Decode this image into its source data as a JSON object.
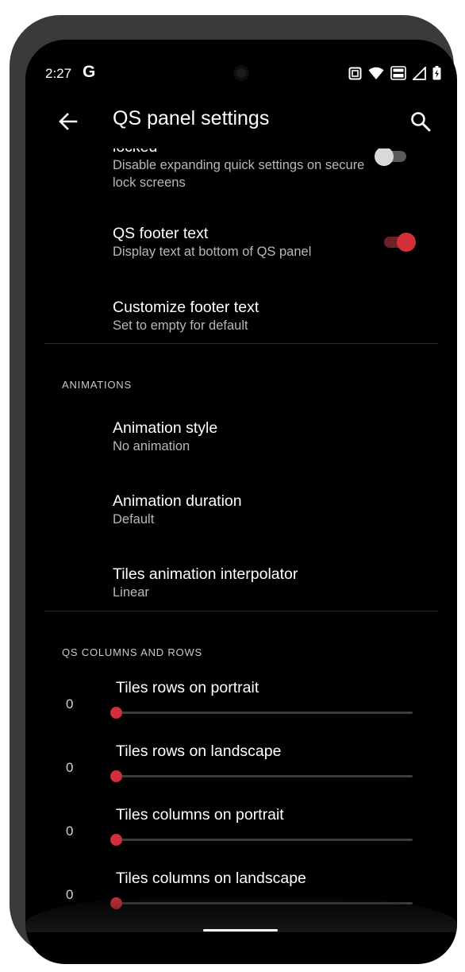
{
  "status_bar": {
    "time": "2:27",
    "g_logo": "G",
    "icons": [
      "screenshot-icon",
      "wifi-icon",
      "volte-icon",
      "signal-icon",
      "battery-charging-icon"
    ]
  },
  "app_bar": {
    "title": "QS panel settings",
    "back_icon": "arrow-back-icon",
    "search_icon": "search-icon"
  },
  "colors": {
    "accent": "#d32f3a",
    "toggle_off_track": "#5a5a5a",
    "toggle_off_thumb": "#d9d9d9",
    "toggle_on_track": "#6d2026"
  },
  "preferences_top": [
    {
      "title": "locked",
      "summary": "Disable expanding quick settings on secure lock screens",
      "toggle": false
    },
    {
      "title": "QS footer text",
      "summary": "Display text at bottom of QS panel",
      "toggle": true
    },
    {
      "title": "Customize footer text",
      "summary": "Set to empty for default"
    }
  ],
  "animations": {
    "header": "ANIMATIONS",
    "items": [
      {
        "title": "Animation style",
        "summary": "No animation"
      },
      {
        "title": "Animation duration",
        "summary": "Default"
      },
      {
        "title": "Tiles animation interpolator",
        "summary": "Linear"
      }
    ]
  },
  "columns_rows": {
    "header": "QS COLUMNS AND ROWS",
    "sliders": [
      {
        "title": "Tiles rows on portrait",
        "value": "0",
        "level": 0
      },
      {
        "title": "Tiles rows on landscape",
        "value": "0",
        "level": 0
      },
      {
        "title": "Tiles columns on portrait",
        "value": "0",
        "level": 0
      },
      {
        "title": "Tiles columns on landscape",
        "value": "0",
        "level": 0
      }
    ]
  }
}
